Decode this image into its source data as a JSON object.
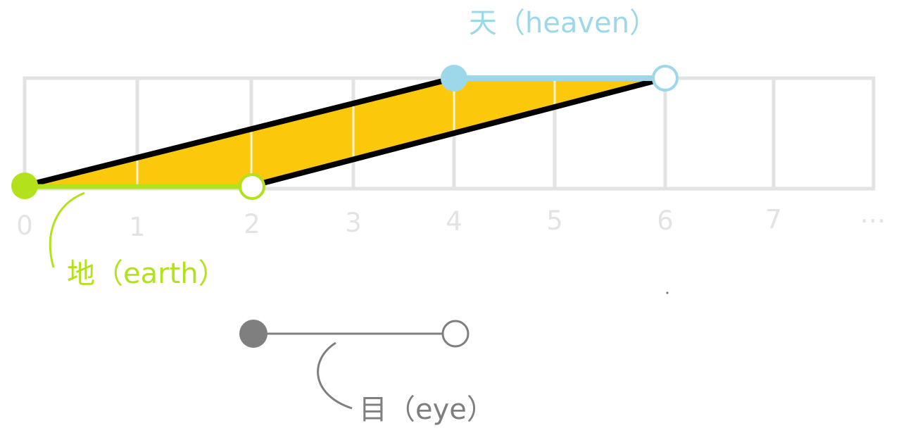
{
  "diagram": {
    "axis_ticks": [
      "0",
      "1",
      "2",
      "3",
      "4",
      "5",
      "6",
      "7",
      "…"
    ],
    "labels": {
      "heaven": "天（heaven）",
      "earth": "地（earth）",
      "eye": "目（eye）"
    },
    "intervals": {
      "heaven": {
        "start": 4,
        "end": 6,
        "start_closed": true,
        "end_closed": false
      },
      "earth": {
        "start": 0,
        "end": 2,
        "start_closed": true,
        "end_closed": false
      },
      "eye": {
        "start_closed": true,
        "end_closed": false
      }
    },
    "colors": {
      "grid": "#e3e3e3",
      "tick_text": "#e3e3e3",
      "band_fill": "#fcc80c",
      "band_edge": "#000000",
      "heaven": "#9dd8ea",
      "earth": "#b3e21c",
      "eye": "#7f7f7f"
    }
  }
}
